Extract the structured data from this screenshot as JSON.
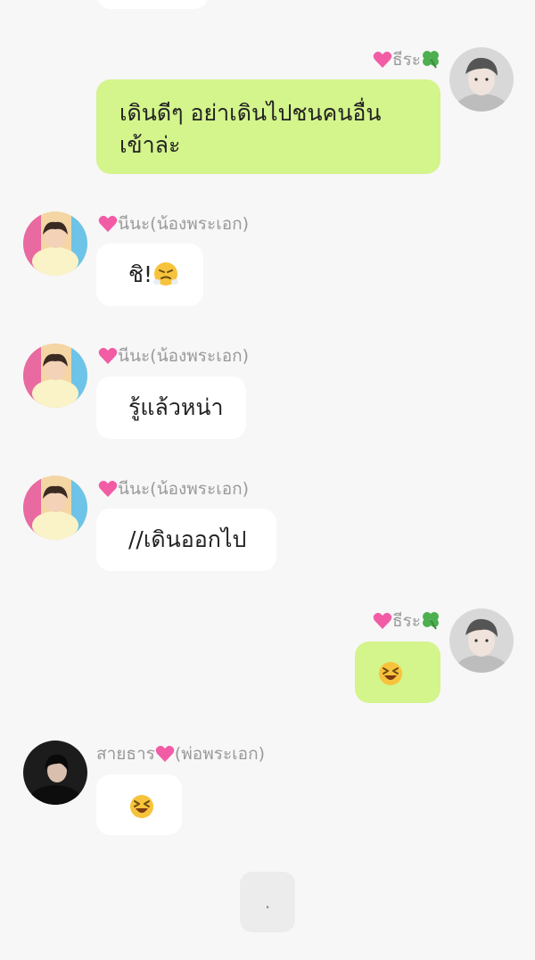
{
  "colors": {
    "background": "#f7f7f7",
    "incoming_bubble": "#ffffff",
    "outgoing_bubble": "#d4f48c",
    "name_text": "#9a9a9a",
    "heart": "#f25ca5",
    "clover": "#4caf50"
  },
  "messages": [
    {
      "sender": "ธีระ",
      "side": "right",
      "name_icons": [
        "heart-icon",
        "clover-icon"
      ],
      "text_line1": "เดินดีๆ อย่าเดินไปชนคนอื่น",
      "text_line2": "เข้าล่ะ"
    },
    {
      "sender": "นีนะ(น้องพระเอก)",
      "side": "left",
      "name_icons": [
        "heart-icon"
      ],
      "text": "ชิ!",
      "emoji": "huffing-face-emoji"
    },
    {
      "sender": "นีนะ(น้องพระเอก)",
      "side": "left",
      "name_icons": [
        "heart-icon"
      ],
      "text": "รู้แล้วหน่า"
    },
    {
      "sender": "นีนะ(น้องพระเอก)",
      "side": "left",
      "name_icons": [
        "heart-icon"
      ],
      "text": "//เดินออกไป"
    },
    {
      "sender": "ธีระ",
      "side": "right",
      "name_icons": [
        "heart-icon",
        "clover-icon"
      ],
      "emoji": "laughing-face-emoji"
    },
    {
      "sender_part1": "สายธาร",
      "sender_part2": "(พ่อพระเอก)",
      "side": "left",
      "name_icons": [
        "heart-icon"
      ],
      "emoji": "laughing-face-emoji"
    }
  ],
  "typing_indicator": "."
}
